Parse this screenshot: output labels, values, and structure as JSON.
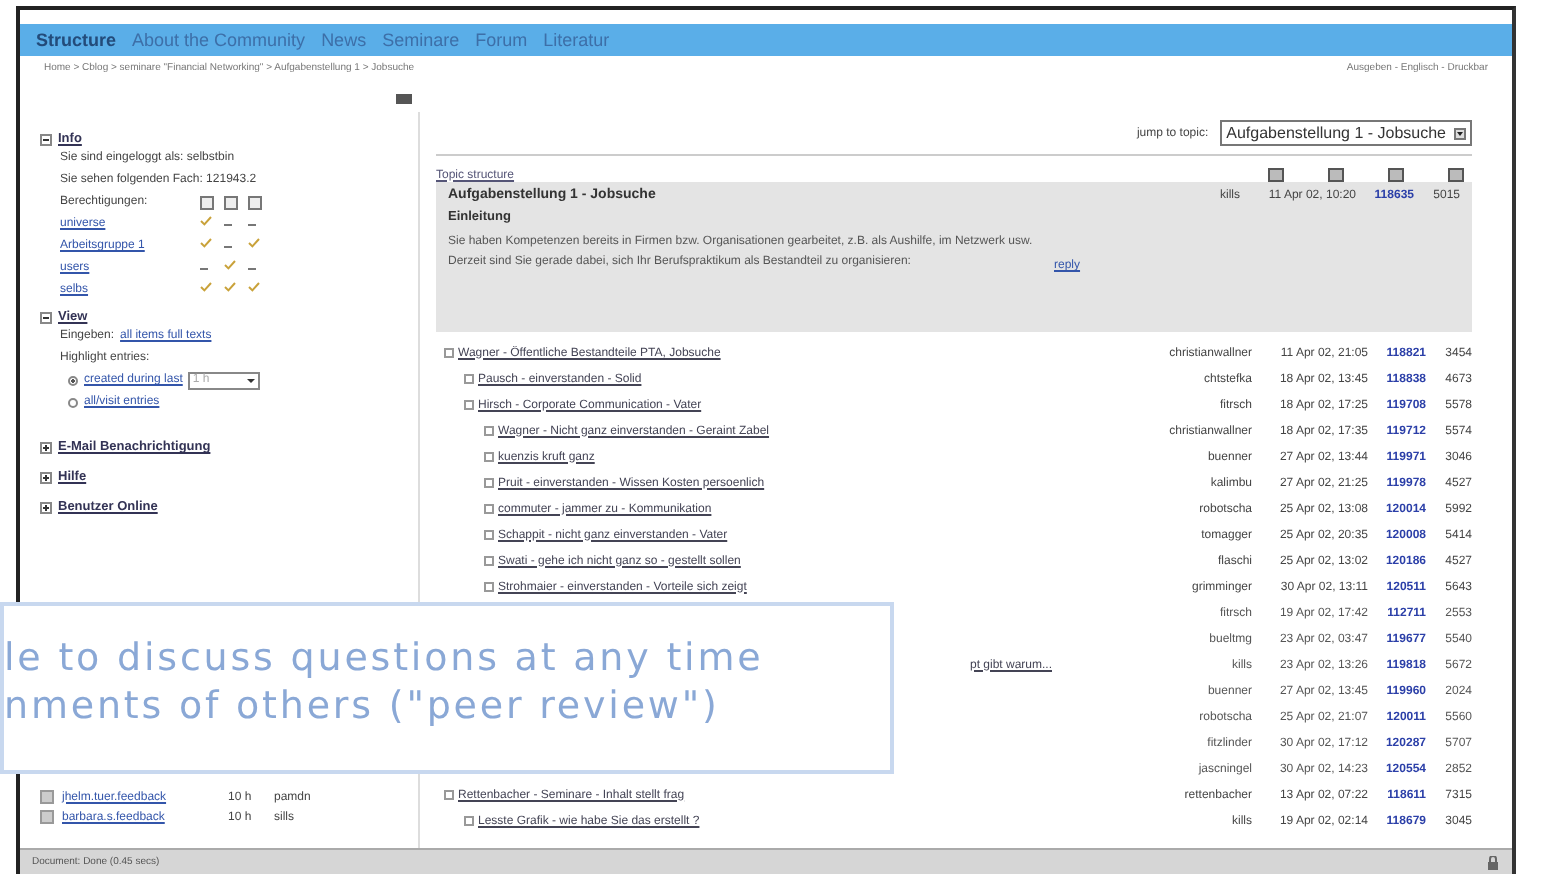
{
  "nav": {
    "items": [
      {
        "label": "Structure",
        "selected": true
      },
      {
        "label": "About the Community",
        "selected": false
      },
      {
        "label": "News",
        "selected": false
      },
      {
        "label": "Seminare",
        "selected": false
      },
      {
        "label": "Forum",
        "selected": false
      },
      {
        "label": "Literatur",
        "selected": false
      }
    ]
  },
  "breadcrumb": "Home > Cblog > seminare \"Financial Networking\" > Aufgabenstellung 1 > Jobsuche",
  "top_links": "Ausgeben - Englisch - Druckbar",
  "sidebar": {
    "info": {
      "title": "Info",
      "expanded": true,
      "lines": [
        "Sie sind eingeloggt als: selbstbin",
        "Sie sehen folgenden Fach: 121943.2"
      ],
      "perm_label": "Berechtigungen:",
      "perms": [
        {
          "name": "universe",
          "allowed": [
            true,
            false,
            false
          ]
        },
        {
          "name": "Arbeitsgruppe 1",
          "allowed": [
            true,
            false,
            true
          ]
        },
        {
          "name": "users",
          "allowed": [
            false,
            true,
            false
          ]
        },
        {
          "name": "selbs",
          "allowed": [
            true,
            true,
            true
          ]
        }
      ]
    },
    "view": {
      "title": "View",
      "expanded": true,
      "show_label": "Eingeben:",
      "show_link": "all items full texts",
      "highlight_label": "Highlight entries:",
      "options": [
        {
          "label": "created during last",
          "selected": true,
          "select": "1 h"
        },
        {
          "label": "all/visit entries",
          "selected": false
        }
      ]
    },
    "sections": [
      {
        "title": "E-Mail Benachrichtigung",
        "expanded": false
      },
      {
        "title": "Hilfe",
        "expanded": false
      },
      {
        "title": "Benutzer Online",
        "expanded": false
      }
    ],
    "online": [
      {
        "name": "jhelm.tuer.feedback",
        "time": "10 h",
        "user": "pamdn"
      },
      {
        "name": "barbara.s.feedback",
        "time": "10 h",
        "user": "sills"
      }
    ]
  },
  "jump_to": {
    "label": "jump to topic:",
    "value": "Aufgabenstellung 1 - Jobsuche"
  },
  "topic_header": "Topic structure",
  "post": {
    "title": "Aufgabenstellung 1 - Jobsuche",
    "subtitle": "Einleitung",
    "body": "Sie haben Kompetenzen bereits in Firmen bzw. Organisationen gearbeitet, z.B. als Aushilfe, im Netzwerk usw. Derzeit sind Sie gerade dabei, sich Ihr Berufspraktikum als Bestandteil zu organisieren:",
    "reply": "reply",
    "author": "kills",
    "date": "11 Apr 02, 10:20",
    "id": "118635",
    "count": "5015"
  },
  "threads": [
    {
      "title": "Wagner - Öffentliche Bestandteile PTA, Jobsuche",
      "author": "christianwallner",
      "date": "11 Apr 02, 21:05",
      "id": "118821",
      "count": "3454",
      "children": [
        {
          "title": "Pausch - einverstanden - Solid",
          "author": "chtstefka",
          "date": "18 Apr 02, 13:45",
          "id": "118838",
          "count": "4673"
        },
        {
          "title": "Hirsch - Corporate Communication - Vater",
          "author": "fitrsch",
          "date": "18 Apr 02, 17:25",
          "id": "119708",
          "count": "5578",
          "children": [
            {
              "title": "Wagner - Nicht ganz einverstanden - Geraint Zabel",
              "author": "christianwallner",
              "date": "18 Apr 02, 17:35",
              "id": "119712",
              "count": "5574"
            },
            {
              "title": "kuenzis kruft ganz",
              "author": "buenner",
              "date": "27 Apr 02, 13:44",
              "id": "119971",
              "count": "3046"
            },
            {
              "title": "Pruit - einverstanden - Wissen Kosten persoenlich",
              "author": "kalimbu",
              "date": "27 Apr 02, 21:25",
              "id": "119978",
              "count": "4527"
            },
            {
              "title": "commuter - jammer zu - Kommunikation",
              "author": "robotscha",
              "date": "25 Apr 02, 13:08",
              "id": "120014",
              "count": "5992"
            },
            {
              "title": "Schappit - nicht ganz einverstanden - Vater",
              "author": "tomagger",
              "date": "25 Apr 02, 20:35",
              "id": "120008",
              "count": "5414"
            },
            {
              "title": "Swati - gehe ich nicht ganz so - gestellt sollen",
              "author": "flaschi",
              "date": "25 Apr 02, 13:02",
              "id": "120186",
              "count": "4527"
            },
            {
              "title": "Strohmaier - einverstanden - Vorteile sich zeigt",
              "author": "grimminger",
              "date": "30 Apr 02, 13:11",
              "id": "120511",
              "count": "5643"
            }
          ]
        }
      ]
    },
    {
      "kind": "covered",
      "author": "fitrsch",
      "date": "19 Apr 02, 17:42",
      "id": "112711",
      "count": "2553"
    },
    {
      "kind": "covered",
      "author": "bueltmg",
      "date": "23 Apr 02, 03:47",
      "id": "119677",
      "count": "5540"
    },
    {
      "kind": "covered",
      "title": "pt gibt warum...",
      "author": "kills",
      "date": "23 Apr 02, 13:26",
      "id": "119818",
      "count": "5672"
    },
    {
      "kind": "covered",
      "author": "buenner",
      "date": "27 Apr 02, 13:45",
      "id": "119960",
      "count": "2024"
    },
    {
      "kind": "covered",
      "author": "robotscha",
      "date": "25 Apr 02, 21:07",
      "id": "120011",
      "count": "5560"
    },
    {
      "kind": "covered",
      "author": "fitzlinder",
      "date": "30 Apr 02, 17:12",
      "id": "120287",
      "count": "5707"
    },
    {
      "kind": "covered",
      "author": "jascningel",
      "date": "30 Apr 02, 14:23",
      "id": "120554",
      "count": "2852"
    },
    {
      "title": "Rettenbacher - Seminare - Inhalt stellt frag",
      "author": "rettenbacher",
      "date": "13 Apr 02, 07:22",
      "id": "118611",
      "count": "7315",
      "children": [
        {
          "title": "Lesste Grafik - wie habe Sie das erstellt ?",
          "author": "kills",
          "date": "19 Apr 02, 02:14",
          "id": "118679",
          "count": "3045"
        }
      ]
    }
  ],
  "status_bar": "Document: Done (0.45 secs)",
  "caption": {
    "lines": [
      "le to discuss questions at any time",
      "nments of others (\"peer review\")"
    ]
  }
}
